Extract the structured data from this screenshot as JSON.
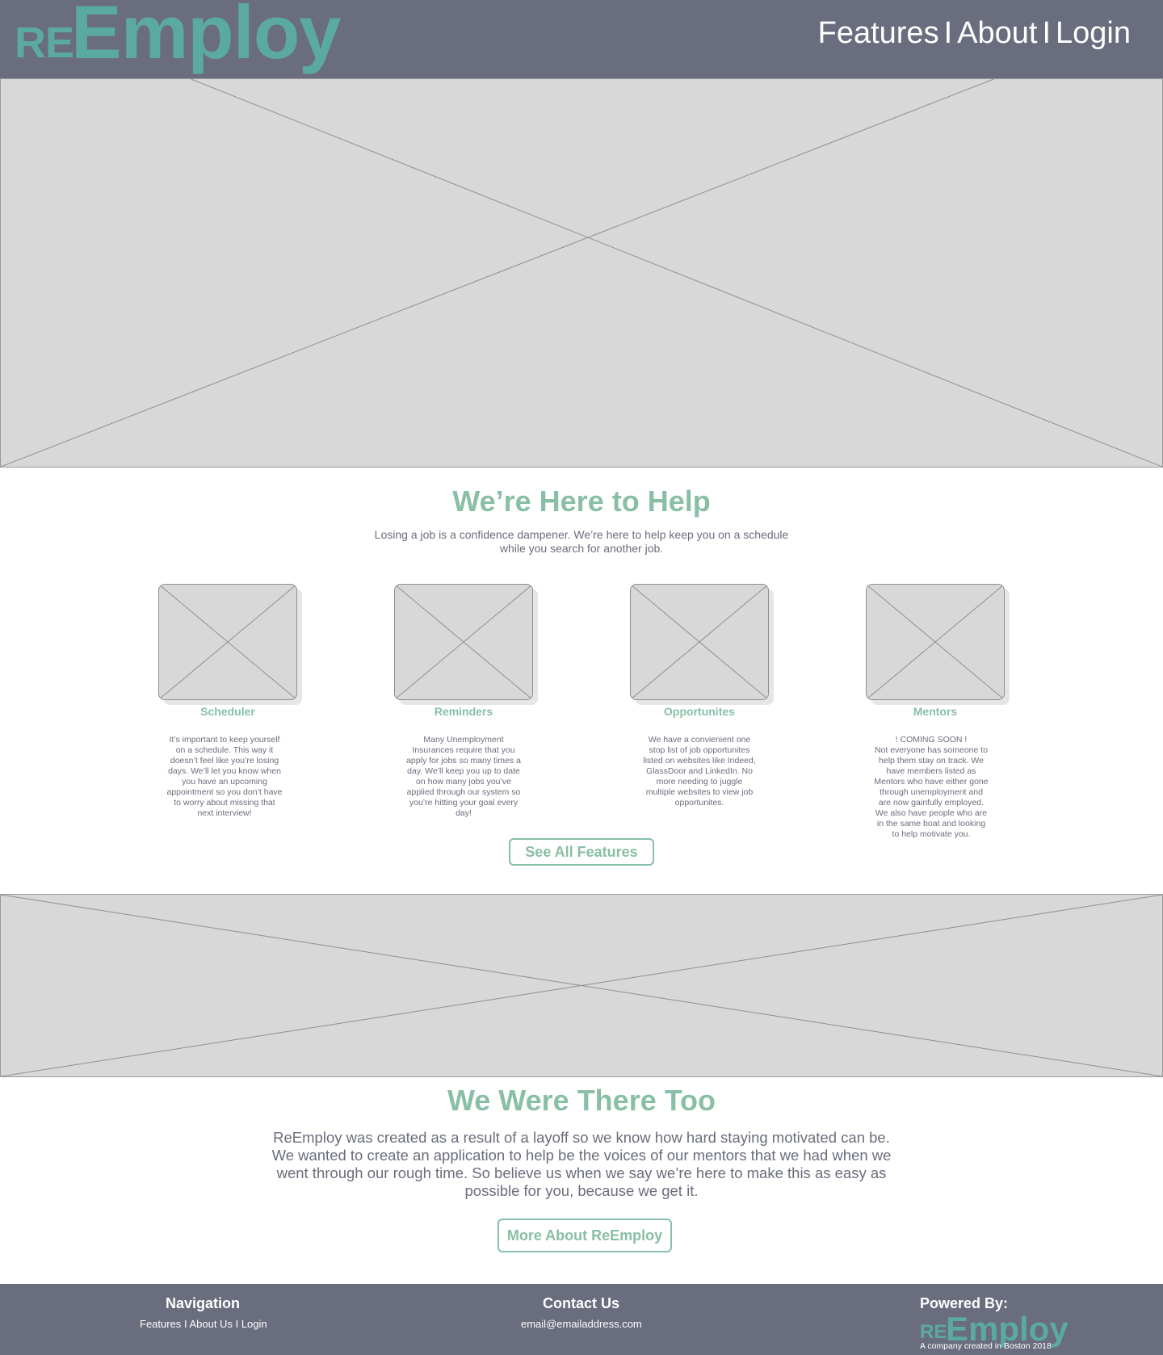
{
  "header": {
    "logo_prefix": "RE",
    "logo_main": "Employ",
    "nav": {
      "features": "Features",
      "about": "About",
      "login": "Login",
      "separator": "I"
    }
  },
  "help": {
    "title": "We’re Here to Help",
    "subtitle_line1": "Losing a job is a confidence dampener. We’re here to help keep you on a schedule",
    "subtitle_line2": "while you search for another job."
  },
  "features": [
    {
      "title": "Scheduler",
      "lines": [
        "It’s important to keep yourself",
        "on a schedule. This way it",
        "doesn’t feel like you’re losing",
        "days. We’ll let you know when",
        "you have an upcoming",
        "appointment so you don’t have",
        "to worry about missing that",
        "next interview!"
      ]
    },
    {
      "title": "Reminders",
      "lines": [
        "Many Unemployment",
        "Insurances require that you",
        "apply for jobs so many times a",
        "day. We’ll keep you up to date",
        "on how many jobs you’ve",
        "applied through our system so",
        "you’re hitting your goal every",
        "day!"
      ]
    },
    {
      "title": "Opportunites",
      "lines": [
        "We have a convienient one",
        "stop list of job opportunites",
        "listed on websites like Indeed,",
        "GlassDoor and LinkedIn. No",
        "more needing to juggle",
        "multiple websites to view job",
        "opportunites."
      ]
    },
    {
      "title": "Mentors",
      "lines": [
        "! COMING SOON !",
        "Not everyone has someone to",
        "help them stay on track. We",
        "have members listed as",
        "Mentors who have either gone",
        "through unemployment and",
        "are now gainfully employed.",
        "We also have people who are",
        "in the same boat and looking",
        "to help motivate you."
      ]
    }
  ],
  "see_all_button": "See All Features",
  "there_too": {
    "title": "We Were There Too",
    "lines": [
      "ReEmploy was created as a result of a layoff so we know how hard staying motivated can be.",
      "We wanted to create an application to help be the voices of our mentors that we had when we",
      "went through our rough time. So believe us when we say we’re here to make this as easy as",
      "possible for you, because we get it."
    ]
  },
  "more_button": "More About ReEmploy",
  "footer": {
    "nav_title": "Navigation",
    "nav_links": {
      "features": "Features",
      "about": "About Us",
      "login": "Login",
      "separator": "I"
    },
    "contact_title": "Contact Us",
    "email": "email@emailaddress.com",
    "powered_title": "Powered By:",
    "logo_prefix": "RE",
    "logo_main": "Employ",
    "tagline": "A company created in Boston 2018"
  },
  "colors": {
    "header_bg": "#6a6d7d",
    "logo": "#5aa9a2",
    "accent": "#88bfa5",
    "placeholder": "#d8d8d8"
  }
}
